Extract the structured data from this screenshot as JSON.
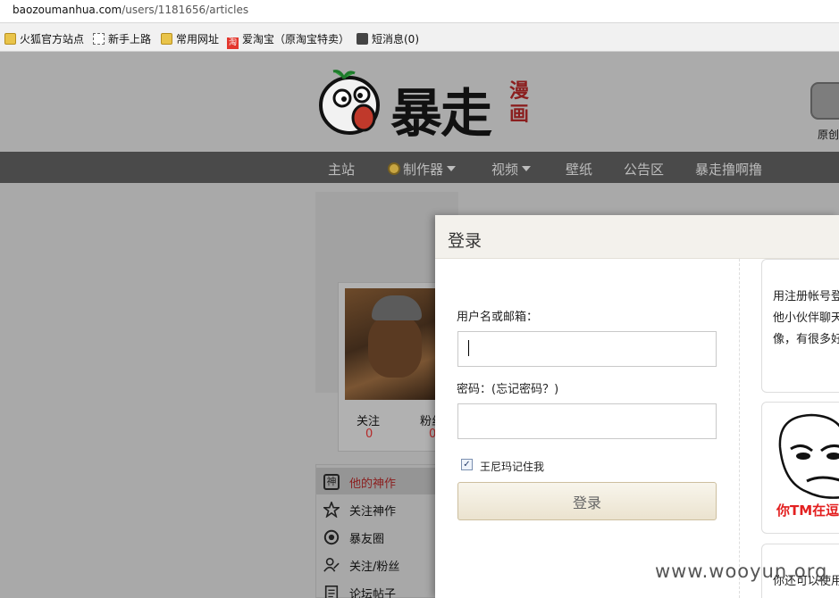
{
  "browser": {
    "url_host": "baozoumanhua.com",
    "url_path": "/users/1181656/articles",
    "bookmarks": [
      {
        "label": "火狐官方站点",
        "icon": "folder-icon"
      },
      {
        "label": "新手上路",
        "icon": "dashed-page-icon"
      },
      {
        "label": "常用网址",
        "icon": "folder-icon"
      },
      {
        "label": "爱淘宝（原淘宝特卖）",
        "icon": "taobao-icon",
        "icon_text": "淘"
      },
      {
        "label": "短消息(0)",
        "icon": "message-icon"
      }
    ]
  },
  "header": {
    "logo_text": "暴走",
    "logo_side": "漫画",
    "original_label": "原创"
  },
  "nav": {
    "items": [
      {
        "label": "主站"
      },
      {
        "label": "制作器",
        "dropdown": true
      },
      {
        "label": "视频",
        "dropdown": true
      },
      {
        "label": "壁纸"
      },
      {
        "label": "公告区"
      },
      {
        "label": "暴走撸啊撸"
      }
    ]
  },
  "profile": {
    "stats": [
      {
        "label": "关注",
        "value": "0"
      },
      {
        "label": "粉丝",
        "value": "0"
      }
    ],
    "menu": [
      {
        "label": "他的神作",
        "icon": "shen-icon",
        "icon_text": "神",
        "active": true
      },
      {
        "label": "关注神作",
        "icon": "star-icon"
      },
      {
        "label": "暴友圈",
        "icon": "circle-icon"
      },
      {
        "label": "关注/粉丝",
        "icon": "user-icon"
      },
      {
        "label": "论坛帖子",
        "icon": "document-icon"
      }
    ]
  },
  "login": {
    "title": "登录",
    "username_label": "用户名或邮箱：",
    "username_value": "",
    "password_label": "密码：(忘记密码？)",
    "password_value": "",
    "remember_label": "王尼玛记住我",
    "remember_checked": true,
    "submit_label": "登录",
    "side_text_lines": [
      "用注册帐号登",
      "他小伙伴聊天",
      "像，有很多好"
    ],
    "rage_caption": "你TM在逗",
    "footer_text": "你还可以使用"
  },
  "watermark": "www.wooyun.org",
  "colors": {
    "nav_bg": "#4a4a4a",
    "accent_red": "#b52a2a",
    "rage_red": "#e32020"
  }
}
